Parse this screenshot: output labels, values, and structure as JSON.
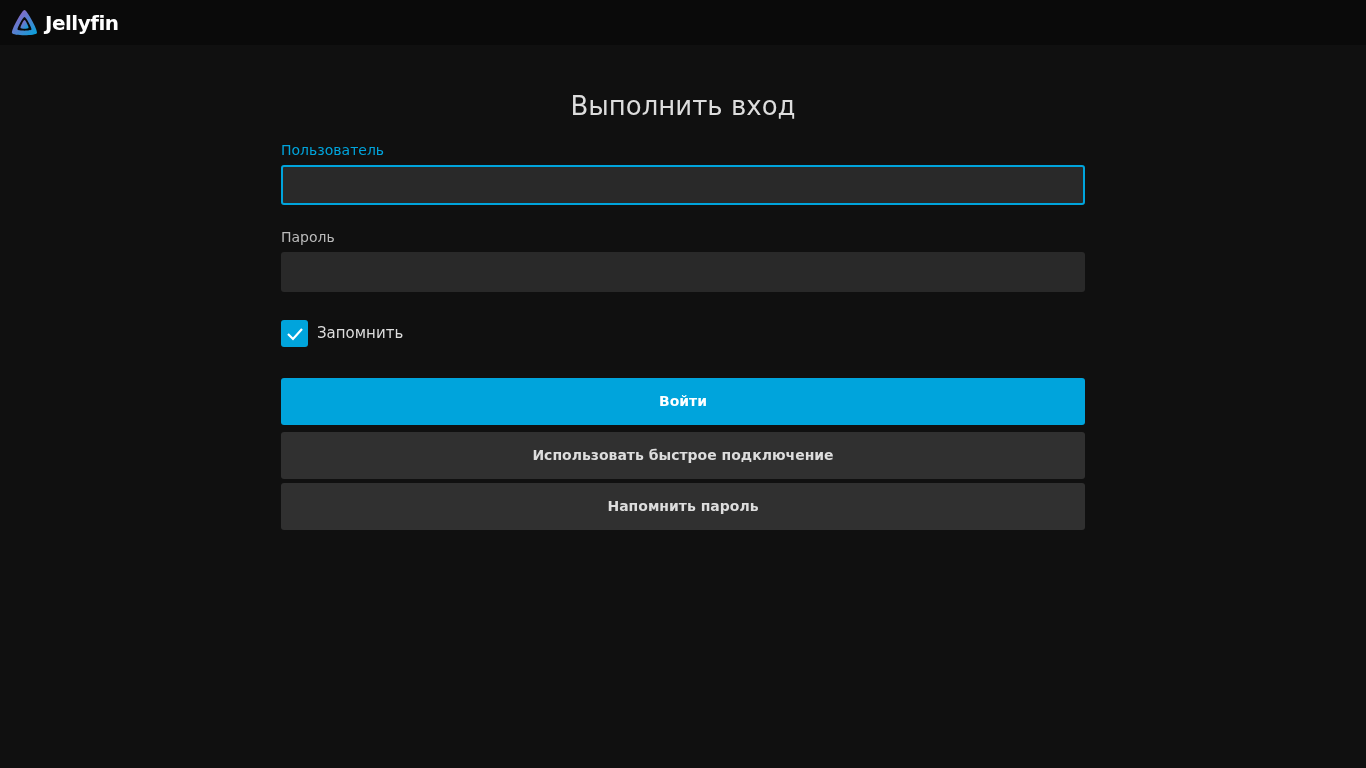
{
  "header": {
    "logo_text": "Jellyfin"
  },
  "title": "Выполнить вход",
  "fields": [
    {
      "label": "Пользователь",
      "focused": true
    },
    {
      "label": "Пароль",
      "focused": false
    }
  ],
  "remember": {
    "label": "Запомнить",
    "checked": true
  },
  "buttons": [
    {
      "label": "Войти",
      "kind": "primary"
    },
    {
      "label": "Использовать быстрое подключение",
      "kind": "secondary"
    },
    {
      "label": "Напомнить пароль",
      "kind": "secondary"
    }
  ]
}
